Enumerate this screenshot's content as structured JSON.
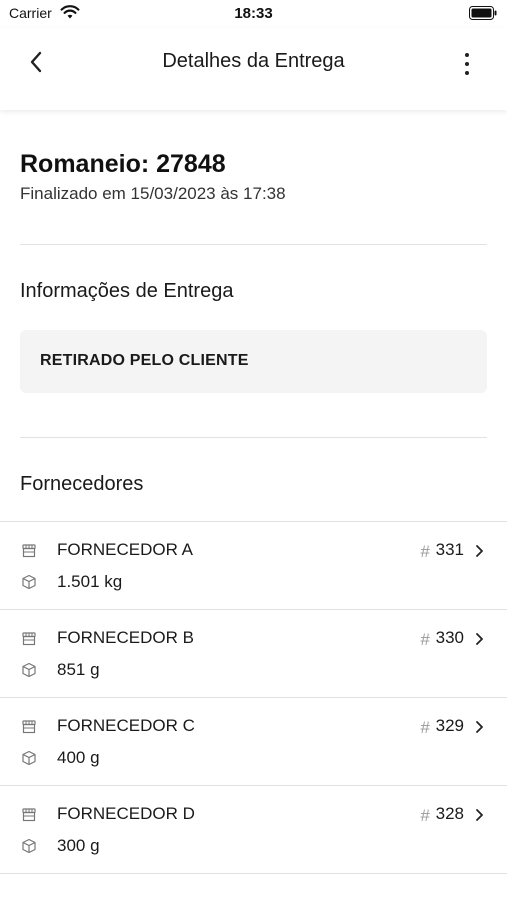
{
  "status_bar": {
    "carrier": "Carrier",
    "time": "18:33"
  },
  "nav": {
    "title": "Detalhes da Entrega"
  },
  "romaneio": {
    "title": "Romaneio: 27848",
    "subtitle": "Finalizado em 15/03/2023 às 17:38"
  },
  "delivery": {
    "section_title": "Informações de Entrega",
    "info": "RETIRADO PELO CLIENTE"
  },
  "suppliers": {
    "section_title": "Fornecedores",
    "items": [
      {
        "name": "FORNECEDOR A",
        "weight": "1.501 kg",
        "hash": "#",
        "number": "331"
      },
      {
        "name": "FORNECEDOR B",
        "weight": "851 g",
        "hash": "#",
        "number": "330"
      },
      {
        "name": "FORNECEDOR C",
        "weight": "400 g",
        "hash": "#",
        "number": "329"
      },
      {
        "name": "FORNECEDOR D",
        "weight": "300 g",
        "hash": "#",
        "number": "328"
      }
    ]
  },
  "icons": {
    "back": "chevron-left-icon",
    "more": "more-vertical-icon",
    "supplier": "store-icon",
    "weight": "box-icon",
    "open": "chevron-right-icon"
  }
}
